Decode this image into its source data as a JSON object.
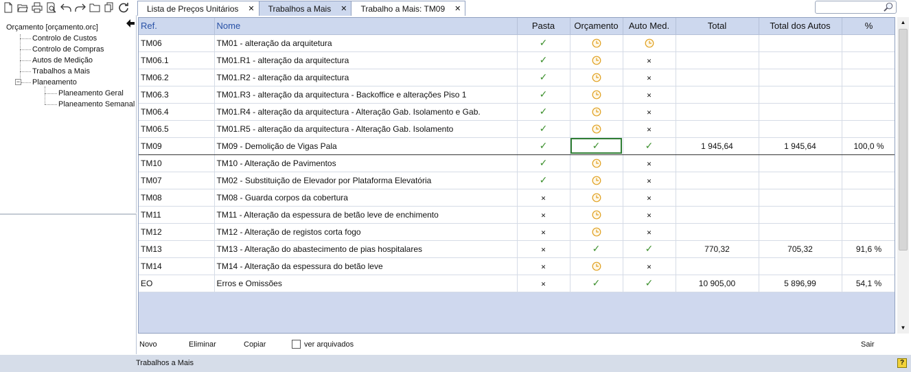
{
  "toolbar": {
    "icons": [
      "new-file-icon",
      "open-folder-icon",
      "print-icon",
      "print-preview-icon",
      "undo-icon",
      "redo-icon",
      "folder-icon",
      "copy-icon",
      "refresh-icon"
    ]
  },
  "tabs": [
    {
      "label": "Lista de Preços Unitários",
      "active": false,
      "closable": true
    },
    {
      "label": "Trabalhos a Mais",
      "active": true,
      "closable": true
    },
    {
      "label": "Trabalho a Mais: TM09",
      "active": false,
      "closable": true
    }
  ],
  "search": {
    "value": "",
    "placeholder": ""
  },
  "tree": {
    "root": "Orçamento [orçamento.orc]",
    "items": [
      "Controlo de Custos",
      "Controlo de Compras",
      "Autos de Medição",
      "Trabalhos a Mais",
      "Planeamento"
    ],
    "planeamento_children": [
      "Planeamento Geral",
      "Planeamento Semanal"
    ]
  },
  "grid": {
    "columns": [
      "Ref.",
      "Nome",
      "Pasta",
      "Orçamento",
      "Auto Med.",
      "Total",
      "Total dos Autos",
      "%"
    ],
    "rows": [
      {
        "ref": "TM06",
        "nome": "TM01 - alteração da arquitetura",
        "pasta": "check",
        "orcamento": "clock",
        "auto": "clock",
        "total": "",
        "total_autos": "",
        "pct": ""
      },
      {
        "ref": "TM06.1",
        "nome": "TM01.R1 - alteração da arquitectura",
        "pasta": "check",
        "orcamento": "clock",
        "auto": "x",
        "total": "",
        "total_autos": "",
        "pct": ""
      },
      {
        "ref": "TM06.2",
        "nome": "TM01.R2 - alteração da arquitectura",
        "pasta": "check",
        "orcamento": "clock",
        "auto": "x",
        "total": "",
        "total_autos": "",
        "pct": ""
      },
      {
        "ref": "TM06.3",
        "nome": "TM01.R3 - alteração da arquitectura - Backoffice e alterações Piso 1",
        "pasta": "check",
        "orcamento": "clock",
        "auto": "x",
        "total": "",
        "total_autos": "",
        "pct": ""
      },
      {
        "ref": "TM06.4",
        "nome": "TM01.R4 - alteração da arquitectura - Alteração Gab. Isolamento e Gab.",
        "pasta": "check",
        "orcamento": "clock",
        "auto": "x",
        "total": "",
        "total_autos": "",
        "pct": ""
      },
      {
        "ref": "TM06.5",
        "nome": "TM01.R5 - alteração da arquitectura - Alteração Gab. Isolamento",
        "pasta": "check",
        "orcamento": "clock",
        "auto": "x",
        "total": "",
        "total_autos": "",
        "pct": ""
      },
      {
        "ref": "TM09",
        "nome": "TM09 - Demolição de Vigas Pala",
        "pasta": "check",
        "orcamento": "check",
        "auto": "check",
        "total": "1 945,64",
        "total_autos": "1 945,64",
        "pct": "100,0 %",
        "selected": true
      },
      {
        "ref": "TM10",
        "nome": "TM10 - Alteração de Pavimentos",
        "pasta": "check",
        "orcamento": "clock",
        "auto": "x",
        "total": "",
        "total_autos": "",
        "pct": ""
      },
      {
        "ref": "TM07",
        "nome": "TM02 - Substituição de Elevador por Plataforma Elevatória",
        "pasta": "check",
        "orcamento": "clock",
        "auto": "x",
        "total": "",
        "total_autos": "",
        "pct": ""
      },
      {
        "ref": "TM08",
        "nome": "TM08 - Guarda corpos da cobertura",
        "pasta": "x",
        "orcamento": "clock",
        "auto": "x",
        "total": "",
        "total_autos": "",
        "pct": ""
      },
      {
        "ref": "TM11",
        "nome": "TM11 - Alteração da espessura de betão leve de enchimento",
        "pasta": "x",
        "orcamento": "clock",
        "auto": "x",
        "total": "",
        "total_autos": "",
        "pct": ""
      },
      {
        "ref": "TM12",
        "nome": "TM12 - Alteração de registos corta fogo",
        "pasta": "x",
        "orcamento": "clock",
        "auto": "x",
        "total": "",
        "total_autos": "",
        "pct": ""
      },
      {
        "ref": "TM13",
        "nome": "TM13 - Alteração do abastecimento de pias hospitalares",
        "pasta": "x",
        "orcamento": "check",
        "auto": "check",
        "total": "770,32",
        "total_autos": "705,32",
        "pct": "91,6 %"
      },
      {
        "ref": "TM14",
        "nome": "TM14 - Alteração da espessura do betão leve",
        "pasta": "x",
        "orcamento": "clock",
        "auto": "x",
        "total": "",
        "total_autos": "",
        "pct": ""
      },
      {
        "ref": "EO",
        "nome": "Erros e Omissões",
        "pasta": "x",
        "orcamento": "check",
        "auto": "check",
        "total": "10 905,00",
        "total_autos": "5 896,99",
        "pct": "54,1 %"
      }
    ]
  },
  "actions": {
    "novo": "Novo",
    "eliminar": "Eliminar",
    "copiar": "Copiar",
    "ver_arquivados": "ver arquivados",
    "ver_arquivados_checked": false,
    "sair": "Sair"
  },
  "status": {
    "text": "Trabalhos a Mais"
  },
  "colors": {
    "header_bg": "#cdd8ee",
    "header_blue_text": "#2851a6",
    "check_green": "#3b8f2b",
    "clock_orange": "#e0a020",
    "status_bg": "#d6dde9"
  }
}
